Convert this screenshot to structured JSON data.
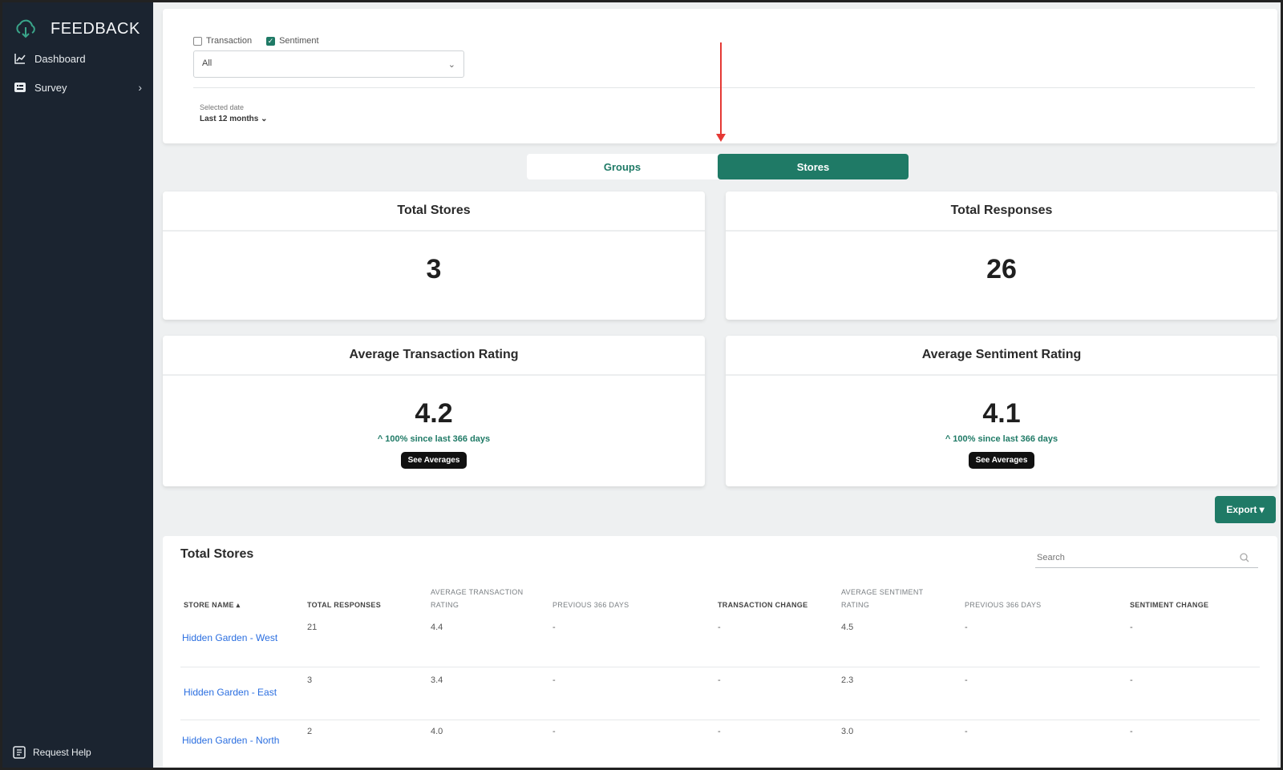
{
  "sidebar": {
    "brand": "FEEDBACK",
    "items": [
      {
        "label": "Dashboard"
      },
      {
        "label": "Survey"
      }
    ],
    "help": "Request Help"
  },
  "filters": {
    "transaction_label": "Transaction",
    "sentiment_label": "Sentiment",
    "transaction_checked": false,
    "sentiment_checked": true,
    "select_value": "All",
    "date_label": "Selected date",
    "date_value": "Last 12 months"
  },
  "toggle": {
    "groups": "Groups",
    "stores": "Stores",
    "active": "Stores"
  },
  "cards": {
    "total_stores": {
      "title": "Total Stores",
      "value": "3"
    },
    "total_responses": {
      "title": "Total Responses",
      "value": "26"
    },
    "avg_transaction": {
      "title": "Average Transaction Rating",
      "value": "4.2",
      "change": "^ 100% since last 366 days",
      "button": "See Averages"
    },
    "avg_sentiment": {
      "title": "Average Sentiment Rating",
      "value": "4.1",
      "change": "^ 100% since last 366 days",
      "button": "See Averages"
    }
  },
  "export_label": "Export ▾",
  "table": {
    "title": "Total Stores",
    "search_placeholder": "Search",
    "headers": {
      "store_name": "STORE NAME ▴",
      "total_responses": "TOTAL RESPONSES",
      "avg_transaction": "AVERAGE TRANSACTION RATING",
      "prev_days_1": "PREVIOUS 366 DAYS",
      "transaction_change": "TRANSACTION CHANGE",
      "avg_sentiment": "AVERAGE SENTIMENT RATING",
      "prev_days_2": "PREVIOUS 366 DAYS",
      "sentiment_change": "SENTIMENT CHANGE"
    },
    "rows": [
      {
        "store": "Hidden Garden - West",
        "responses": "21",
        "avg_transaction": "4.4",
        "prev1": "-",
        "trans_change": "-",
        "avg_sentiment": "4.5",
        "prev2": "-",
        "sent_change": "-"
      },
      {
        "store": "Hidden Garden - East",
        "responses": "3",
        "avg_transaction": "3.4",
        "prev1": "-",
        "trans_change": "-",
        "avg_sentiment": "2.3",
        "prev2": "-",
        "sent_change": "-"
      },
      {
        "store": "Hidden Garden - North",
        "responses": "2",
        "avg_transaction": "4.0",
        "prev1": "-",
        "trans_change": "-",
        "avg_sentiment": "3.0",
        "prev2": "-",
        "sent_change": "-"
      }
    ]
  },
  "colors": {
    "sidebar_bg": "#1b2430",
    "accent": "#1f7a66",
    "link": "#2a6ee0",
    "annotation_arrow": "#e53935"
  }
}
